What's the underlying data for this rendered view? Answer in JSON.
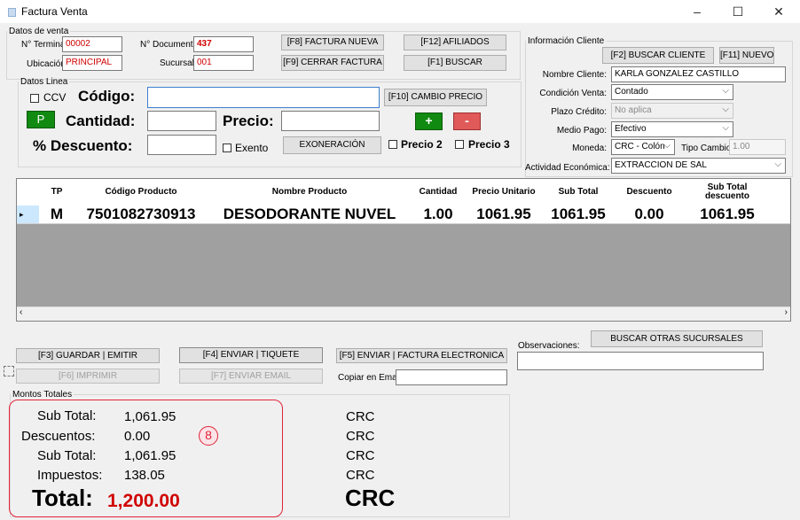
{
  "window": {
    "title": "Factura Venta",
    "min": "–",
    "max": "☐",
    "close": "✕"
  },
  "datos_venta": {
    "legend": "Datos de venta",
    "terminal_label": "N° Terminal:",
    "terminal": "00002",
    "documento_label": "N° Documento:",
    "documento": "437",
    "ubicacion_label": "Ubicación:",
    "ubicacion": "PRINCIPAL",
    "sucursal_label": "Sucursal:",
    "sucursal": "001"
  },
  "top_buttons": {
    "factura_nueva": "[F8] FACTURA NUEVA",
    "afiliados": "[F12] AFILIADOS",
    "cerrar_factura": "[F9] CERRAR FACTURA",
    "buscar": "[F1] BUSCAR"
  },
  "datos_linea": {
    "legend": "Datos Linea",
    "ccv": "CCV",
    "codigo_label": "Código:",
    "codigo": "",
    "cambio_precio": "[F10] CAMBIO PRECIO",
    "p_button": "P",
    "cantidad_label": "Cantidad:",
    "cantidad": "",
    "precio_label": "Precio:",
    "precio": "",
    "plus": "+",
    "minus": "-",
    "descuento_label": "% Descuento:",
    "descuento": "",
    "exento": "Exento",
    "exoneracion": "EXONERACIÓN",
    "precio2": "Precio 2",
    "precio3": "Precio 3"
  },
  "cliente": {
    "legend": "Información Cliente",
    "buscar_cliente": "[F2] BUSCAR CLIENTE",
    "nuevo": "[F11] NUEVO",
    "nombre_label": "Nombre Cliente:",
    "nombre": "KARLA GONZALEZ CASTILLO",
    "condicion_label": "Condición Venta:",
    "condicion": "Contado",
    "plazo_label": "Plazo Crédito:",
    "plazo": "No aplica",
    "medio_label": "Medio Pago:",
    "medio": "Efectivo",
    "moneda_label": "Moneda:",
    "moneda": "CRC - Colón",
    "tipo_cambio_label": "Tipo Cambio:",
    "tipo_cambio": "1.00",
    "actividad_label": "Actividad Económica:",
    "actividad": "EXTRACCION DE SAL"
  },
  "grid": {
    "headers": [
      "TP",
      "Código Producto",
      "Nombre Producto",
      "Cantidad",
      "Precio Unitario",
      "Sub Total",
      "Descuento",
      "Sub Total descuento"
    ],
    "rows": [
      {
        "tp": "M",
        "codigo": "7501082730913",
        "nombre": "DESODORANTE NUVEL",
        "cantidad": "1.00",
        "precio": "1061.95",
        "subtotal": "1061.95",
        "descuento": "0.00",
        "subtotal_desc": "1061.95"
      }
    ]
  },
  "actions": {
    "guardar": "[F3] GUARDAR | EMITIR",
    "enviar_tiquete": "[F4] ENVIAR | TIQUETE",
    "enviar_factura": "[F5] ENVIAR | FACTURA ELECTRONICA",
    "imprimir": "[F6] IMPRIMIR",
    "enviar_email": "[F7] ENVIAR EMAIL",
    "copiar_email_label": "Copiar en Email:",
    "copiar_email": "",
    "buscar_sucursales": "BUSCAR OTRAS SUCURSALES",
    "observaciones_label": "Observaciones:",
    "observaciones": ""
  },
  "totales": {
    "legend": "Montos Totales",
    "subtotal_label": "Sub Total:",
    "subtotal": "1,061.95",
    "subtotal_cur": "CRC",
    "descuentos_label": "Descuentos:",
    "descuentos": "0.00",
    "descuentos_cur": "CRC",
    "subtotal2_label": "Sub Total:",
    "subtotal2": "1,061.95",
    "subtotal2_cur": "CRC",
    "impuestos_label": "Impuestos:",
    "impuestos": "138.05",
    "impuestos_cur": "CRC",
    "total_label": "Total:",
    "total": "1,200.00",
    "total_cur": "CRC",
    "annotation": "8"
  },
  "colors": {
    "accent_red": "#d00000",
    "green": "#118a11",
    "annotation": "#e0243a"
  }
}
